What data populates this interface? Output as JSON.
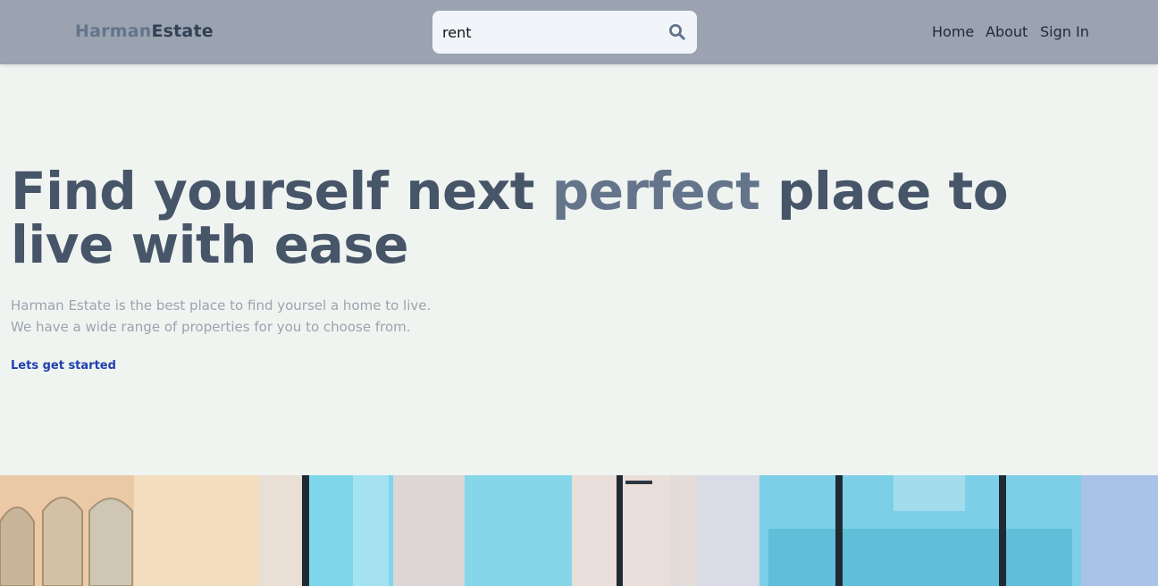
{
  "header": {
    "logo_part1": "Harman",
    "logo_part2": "Estate",
    "search_value": "rent",
    "nav": [
      "Home",
      "About",
      "Sign In"
    ]
  },
  "hero": {
    "title_part1": "Find yourself next ",
    "title_accent": "perfect",
    "title_part2": " place to live with ease",
    "desc_line1": "Harman Estate is the best place to find yoursel a home to live.",
    "desc_line2": "We have a wide range of properties for you to choose from.",
    "cta_label": "Lets get started"
  },
  "colors": {
    "header_bg": "#9ba3b0",
    "page_bg": "#f0f4f1",
    "heading": "#475569",
    "accent": "#64748b",
    "link": "#1e40af"
  },
  "icons": {
    "search": "search-icon",
    "banner": "living-room-photo"
  }
}
